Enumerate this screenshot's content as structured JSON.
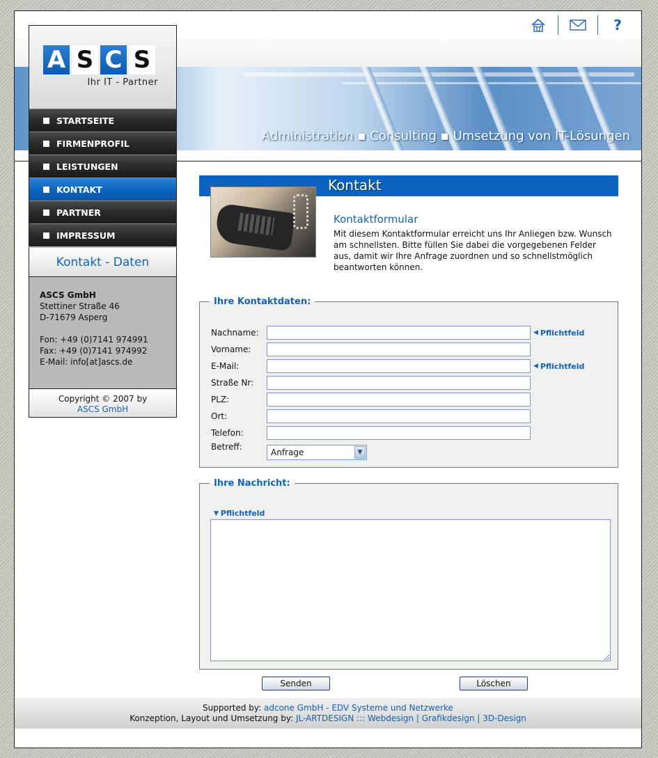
{
  "topbar": {
    "icons": [
      "home-icon",
      "mail-icon",
      "help-icon"
    ],
    "help_glyph": "?"
  },
  "header": {
    "tagline": "Administration ▪ Consulting ▪ Umsetzung von IT-Lösungen"
  },
  "logo": {
    "letters": [
      "A",
      "S",
      "C",
      "S"
    ],
    "subtitle": "Ihr IT - Partner"
  },
  "nav": {
    "items": [
      {
        "label": "STARTSEITE"
      },
      {
        "label": "FIRMENPROFIL"
      },
      {
        "label": "LEISTUNGEN"
      },
      {
        "label": "KONTAKT"
      },
      {
        "label": "PARTNER"
      },
      {
        "label": "IMPRESSUM"
      }
    ],
    "active_index": 3
  },
  "sidebar": {
    "contact_heading": "Kontakt - Daten",
    "company": "ASCS GmbH",
    "street": "Stettiner Straße 46",
    "city": "D-71679 Asperg",
    "phone": "Fon: +49 (0)7141 974991",
    "fax": "Fax: +49 (0)7141 974992",
    "email": "E-Mail: info[at]ascs.de",
    "copyright": "Copyright © 2007 by",
    "copyright_link": "ASCS GmbH"
  },
  "content": {
    "title": "Kontakt",
    "form_heading": "Kontaktformular",
    "intro": "Mit diesem Kontaktformular erreicht uns Ihr Anliegen bzw. Wunsch am schnellsten. Bitte füllen Sie dabei die vorgegebenen Felder aus, damit wir Ihre Anfrage zuordnen und so schnellstmöglich beantworten können."
  },
  "form": {
    "contact_legend": "Ihre Kontaktdaten:",
    "required_label": "Pflichtfeld",
    "fields": {
      "nachname": {
        "label": "Nachname:",
        "value": ""
      },
      "vorname": {
        "label": "Vorname:",
        "value": ""
      },
      "email": {
        "label": "E-Mail:",
        "value": ""
      },
      "strasse": {
        "label": "Straße Nr:",
        "value": ""
      },
      "plz": {
        "label": "PLZ:",
        "value": ""
      },
      "ort": {
        "label": "Ort:",
        "value": ""
      },
      "telefon": {
        "label": "Telefon:",
        "value": ""
      },
      "betreff": {
        "label": "Betreff:",
        "value": "Anfrage"
      }
    },
    "message_legend": "Ihre Nachricht:",
    "message_value": "",
    "submit_label": "Senden",
    "reset_label": "Löschen"
  },
  "footer": {
    "supported_prefix": "Supported by:",
    "supported_link": "adcone GmbH - EDV Systeme und Netzwerke",
    "credits_prefix": "Konzeption, Layout und Umsetzung by:",
    "credits_link": "JL-ARTDESIGN ::: Webdesign | Grafikdesign | 3D-Design"
  },
  "colors": {
    "accent": "#0b63bf",
    "link": "#1462b2",
    "nav_dark": "#2a2a2a"
  }
}
